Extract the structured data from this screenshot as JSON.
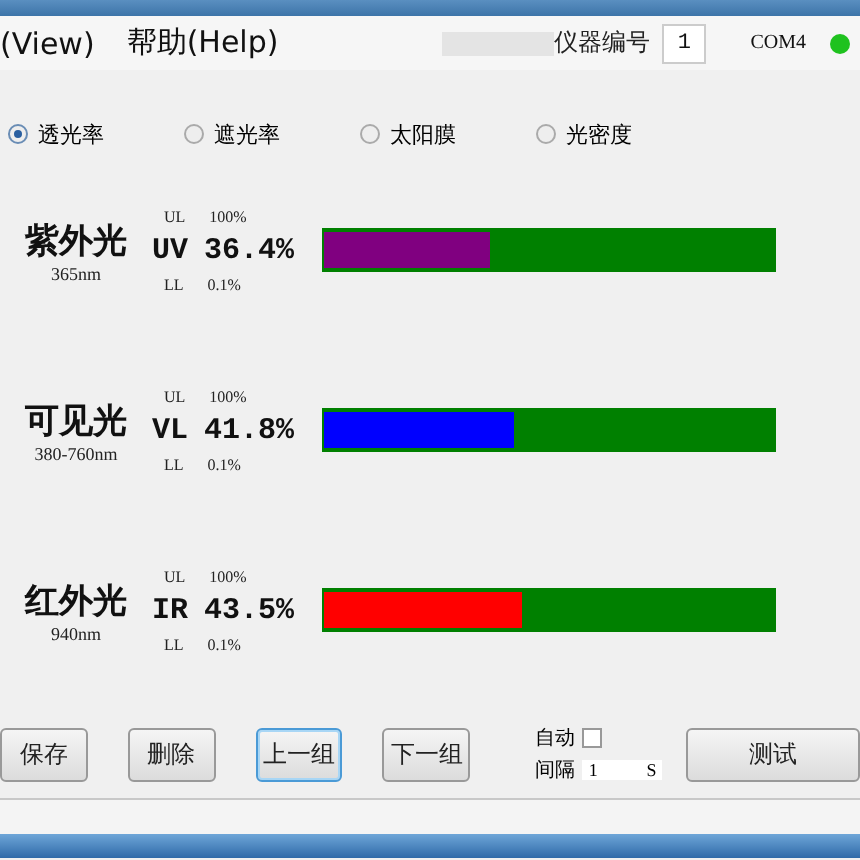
{
  "menu": [
    {
      "label": "(View)"
    },
    {
      "label": "帮助(Help)"
    }
  ],
  "device": {
    "label": "仪器编号",
    "value": "1"
  },
  "port": {
    "label": "COM4",
    "connected": true
  },
  "modes": [
    {
      "label": "透光率",
      "selected": true
    },
    {
      "label": "遮光率",
      "selected": false
    },
    {
      "label": "太阳膜",
      "selected": false
    },
    {
      "label": "光密度",
      "selected": false
    }
  ],
  "channels": [
    {
      "name": "紫外光",
      "wavelength": "365nm",
      "ul_label": "UL",
      "ul": "100%",
      "code": "UV",
      "reading": "36.4%",
      "ll_label": "LL",
      "ll": "0.1%",
      "level": 0.37,
      "color": "#800080"
    },
    {
      "name": "可见光",
      "wavelength": "380-760nm",
      "ul_label": "UL",
      "ul": "100%",
      "code": "VL",
      "reading": "41.8%",
      "ll_label": "LL",
      "ll": "0.1%",
      "level": 0.42,
      "color": "#0000ff"
    },
    {
      "name": "红外光",
      "wavelength": "940nm",
      "ul_label": "UL",
      "ul": "100%",
      "code": "IR",
      "reading": "43.5%",
      "ll_label": "LL",
      "ll": "0.1%",
      "level": 0.44,
      "color": "#ff0000"
    }
  ],
  "buttons": [
    {
      "label": "保存",
      "focused": false
    },
    {
      "label": "删除",
      "focused": false
    },
    {
      "label": "上一组",
      "focused": true
    },
    {
      "label": "下一组",
      "focused": false
    }
  ],
  "auto": {
    "label": "自动",
    "checked": false,
    "interval_label": "间隔",
    "interval": "1",
    "unit": "S"
  },
  "test_button": {
    "label": "测试"
  }
}
